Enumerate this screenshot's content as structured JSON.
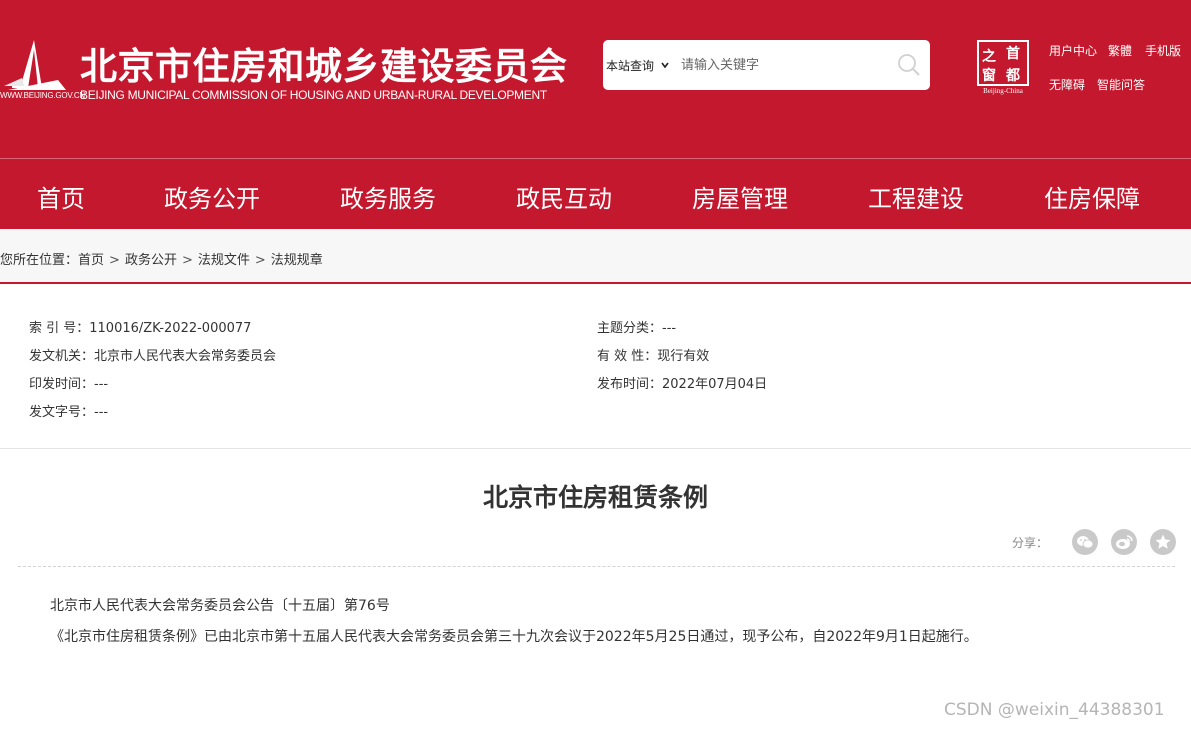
{
  "header": {
    "logo_url_text": "WWW.BEIJING.GOV.CN",
    "title": "北京市住房和城乡建设委员会",
    "subtitle": "BEIJING MUNICIPAL COMMISSION OF HOUSING AND URBAN-RURAL DEVELOPMENT",
    "search": {
      "scope": "本站查询",
      "placeholder": "请输入关键字"
    },
    "seal": {
      "chars": [
        "之",
        "首",
        "窗",
        "都"
      ],
      "caption": "Beijing-China"
    },
    "links": [
      "用户中心",
      "繁體",
      "手机版",
      "无障碍",
      "智能问答"
    ]
  },
  "nav": {
    "items": [
      "首页",
      "政务公开",
      "政务服务",
      "政民互动",
      "房屋管理",
      "工程建设",
      "住房保障"
    ]
  },
  "breadcrumb": {
    "prefix": "您所在位置：",
    "items": [
      "首页",
      "政务公开",
      "法规文件",
      "法规规章"
    ],
    "separator": ">"
  },
  "meta": {
    "index_no": "索 引 号：110016/ZK-2022-000077",
    "topic": "主题分类：---",
    "issuer": "发文机关：北京市人民代表大会常务委员会",
    "validity": "有 效 性：现行有效",
    "print_date": "印发时间：---",
    "publish_date": "发布时间：2022年07月04日",
    "doc_no": "发文字号：---"
  },
  "article": {
    "title": "北京市住房租赁条例",
    "share_label": "分享：",
    "paragraphs": [
      "北京市人民代表大会常务委员会公告〔十五届〕第76号",
      "《北京市住房租赁条例》已由北京市第十五届人民代表大会常务委员会第三十九次会议于2022年5月25日通过，现予公布，自2022年9月1日起施行。"
    ]
  },
  "watermark": "CSDN @weixin_44388301",
  "colors": {
    "brand_red": "#c3182d",
    "breadcrumb_bg": "#f7f7f7",
    "share_icon_gray": "#c9c9c9"
  },
  "icons": [
    "beijing-tower-logo-icon",
    "chevron-down-icon",
    "search-icon",
    "wechat-icon",
    "weibo-icon",
    "favorite-star-icon"
  ]
}
